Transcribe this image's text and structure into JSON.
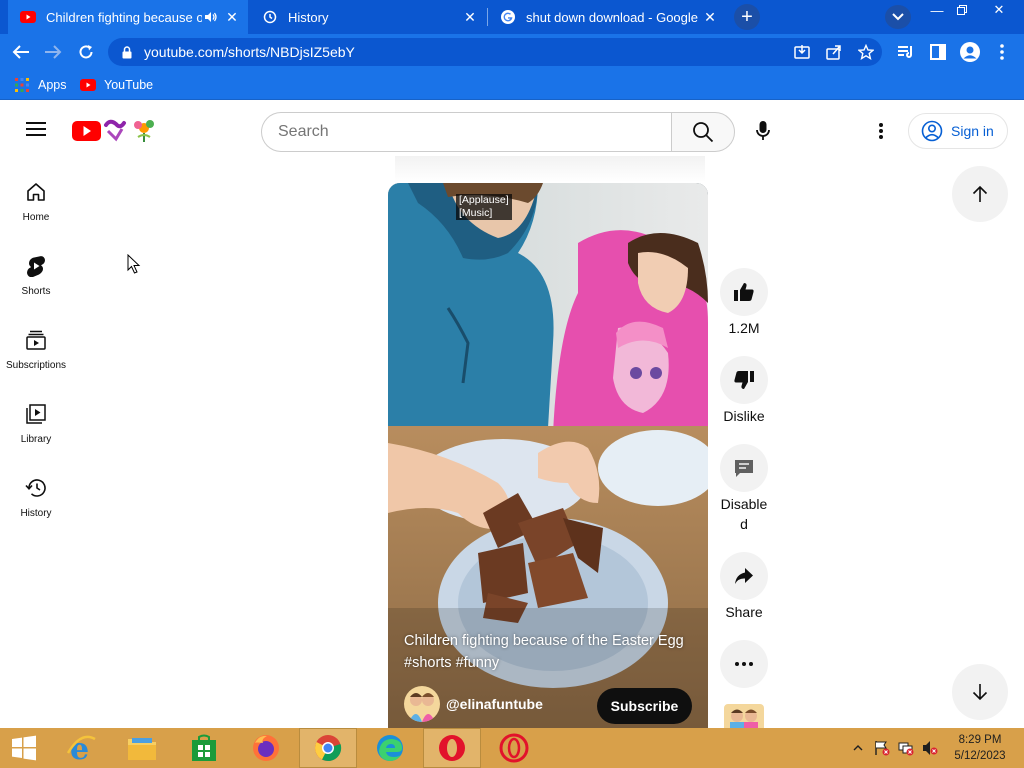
{
  "browser": {
    "tabs": [
      {
        "title": "Children fighting because of the Easter Egg",
        "active": true
      },
      {
        "title": "History",
        "active": false
      },
      {
        "title": "shut down download - Google Search",
        "active": false
      }
    ],
    "new_tab_label": "+",
    "url": "youtube.com/shorts/NBDjsIZ5ebY",
    "bookmarks": [
      {
        "label": "Apps",
        "icon": "apps-grid-icon"
      },
      {
        "label": "YouTube",
        "icon": "youtube-icon"
      }
    ]
  },
  "masthead": {
    "search_placeholder": "Search",
    "sign_in_label": "Sign in"
  },
  "guide": {
    "items": [
      {
        "label": "Home",
        "icon": "home-icon"
      },
      {
        "label": "Shorts",
        "icon": "shorts-icon"
      },
      {
        "label": "Subscriptions",
        "icon": "subscriptions-icon"
      },
      {
        "label": "Library",
        "icon": "library-icon"
      },
      {
        "label": "History",
        "icon": "history-icon"
      }
    ]
  },
  "short": {
    "captions": [
      "[Applause]",
      "[Music]"
    ],
    "title": "Children fighting because of the Easter Egg #shorts #funny",
    "channel": "@elinafuntube",
    "subscribe_label": "Subscribe"
  },
  "actions": {
    "like_count": "1.2M",
    "dislike_label": "Dislike",
    "comments_label_line1": "Disable",
    "comments_label_line2": "d",
    "share_label": "Share"
  },
  "taskbar": {
    "apps": [
      "start",
      "internet-explorer",
      "file-explorer",
      "store",
      "firefox",
      "chrome",
      "edge",
      "opera",
      "opera-gx"
    ],
    "time": "8:29 PM",
    "date": "5/12/2023"
  },
  "colors": {
    "chrome_frame": "#0b57d0",
    "chrome_active_tab": "#1a73e8",
    "yt_red": "#ff0000",
    "link_blue": "#065fd4",
    "taskbar": "#d8a04a"
  }
}
